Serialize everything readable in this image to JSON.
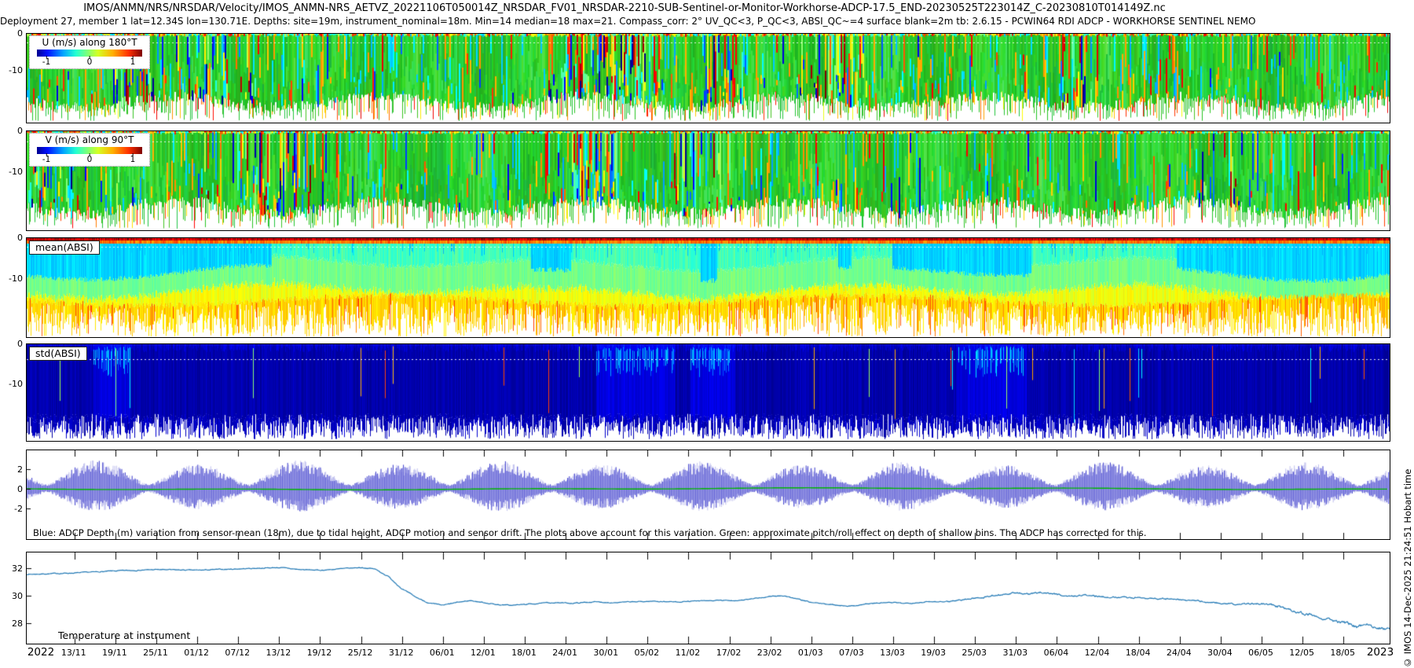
{
  "header": {
    "title_line1": "IMOS/ANMN/NRS/NRSDAR/Velocity/IMOS_ANMN-NRS_AETVZ_20221106T050014Z_NRSDAR_FV01_NRSDAR-2210-SUB-Sentinel-or-Monitor-Workhorse-ADCP-17.5_END-20230525T223014Z_C-20230810T014149Z.nc",
    "title_line2": "Deployment 27, member 1 lat=12.34S lon=130.71E. Depths: site=19m, instrument_nominal=18m. Min=14 median=18 max=21. Compass_corr: 2° UV_QC<3, P_QC<3, ABSI_QC~=4 surface blank=2m tb: 2.6.15 - PCWIN64 RDI ADCP - WORKHORSE SENTINEL NEMO"
  },
  "credit_vertical": "© IMOS 14-Dec-2025 21:24:51 Hobart time",
  "colors": {
    "temperature_line": "#1f77b4",
    "tide_blue": "#2d2dc8",
    "pitch_roll_green": "#00b400",
    "std_navy": "#000f96"
  },
  "panels": [
    {
      "label": "U (m/s) along 180°T",
      "colorbar_ticks": [
        "-1",
        "0",
        "1"
      ],
      "y_ticks": [
        {
          "label": "0",
          "frac": 0.0
        },
        {
          "label": "-10",
          "frac": 0.41
        }
      ]
    },
    {
      "label": "V (m/s) along 90°T",
      "colorbar_ticks": [
        "-1",
        "0",
        "1"
      ],
      "y_ticks": [
        {
          "label": "0",
          "frac": 0.0
        },
        {
          "label": "-10",
          "frac": 0.41
        }
      ]
    },
    {
      "label": "mean(ABSI)",
      "y_ticks": [
        {
          "label": "0",
          "frac": 0.0
        },
        {
          "label": "-10",
          "frac": 0.41
        }
      ]
    },
    {
      "label": "std(ABSI)",
      "y_ticks": [
        {
          "label": "0",
          "frac": 0.0
        },
        {
          "label": "-10",
          "frac": 0.41
        }
      ]
    },
    {
      "annotation": "Blue: ADCP Depth (m) variation from sensor-mean (18m), due to tidal height, ADCP motion and sensor drift. The plots above account for this variation. Green: approximate pitch/roll effect on depth of shallow bins. The ADCP has corrected for this.",
      "y_ticks": [
        {
          "label": "2",
          "frac": 0.217
        },
        {
          "label": "0",
          "frac": 0.435
        },
        {
          "label": "-2",
          "frac": 0.652
        }
      ]
    },
    {
      "label": "Temperature at instrument",
      "y_ticks": [
        {
          "label": "32",
          "frac": 0.178
        },
        {
          "label": "30",
          "frac": 0.475
        },
        {
          "label": "28",
          "frac": 0.772
        }
      ]
    }
  ],
  "x_axis": {
    "start_year_label": "2022",
    "end_year_label": "2023",
    "first_tick_day": 7,
    "tick_interval_days": 6,
    "total_days": 200,
    "date_labels": [
      "13/11",
      "19/11",
      "25/11",
      "01/12",
      "07/12",
      "13/12",
      "19/12",
      "25/12",
      "31/12",
      "06/01",
      "12/01",
      "18/01",
      "24/01",
      "30/01",
      "05/02",
      "11/02",
      "17/02",
      "23/02",
      "01/03",
      "07/03",
      "13/03",
      "19/03",
      "25/03",
      "31/03",
      "06/04",
      "12/04",
      "18/04",
      "24/04",
      "30/04",
      "06/05",
      "12/05",
      "18/05"
    ]
  },
  "chart_data": [
    {
      "panel": "u_velocity",
      "type": "heatmap",
      "label": "U (m/s) along 180°T",
      "colormap": "jet",
      "colorbar_range": [
        -1,
        1
      ],
      "colorbar_tick_labels": [
        "-1",
        "0",
        "1"
      ],
      "depth_tick_labels": [
        "0",
        "-10"
      ],
      "x_range": "06 Nov 2022 – 25 May 2023",
      "appearance": "time-depth velocity profiles, predominantly green (~0 to 0.3 m/s) vertical columns with scattered cyan, yellow, orange, red and dark-blue columns and ragged column bottoms"
    },
    {
      "panel": "v_velocity",
      "type": "heatmap",
      "label": "V (m/s) along 90°T",
      "colormap": "jet",
      "colorbar_range": [
        -1,
        1
      ],
      "colorbar_tick_labels": [
        "-1",
        "0",
        "1"
      ],
      "depth_tick_labels": [
        "0",
        "-10"
      ],
      "x_range": "06 Nov 2022 – 25 May 2023",
      "appearance": "same style as U panel; mostly green with sporadic multicoloured event columns"
    },
    {
      "panel": "mean_absi",
      "type": "heatmap",
      "label": "mean(ABSI)",
      "colormap": "jet",
      "depth_tick_labels": [
        "0",
        "-10"
      ],
      "appearance": "red/orange band at surface, cyan-turquoise upper layer, green middle, yellow lower layer ending in ragged yellow/orange spikes; darker green patches in several time intervals"
    },
    {
      "panel": "std_absi",
      "type": "heatmap",
      "label": "std(ABSI)",
      "colormap": "jet",
      "depth_tick_labels": [
        "0",
        "-10"
      ],
      "appearance": "uniform dark navy field with sparse bright cyan/green/orange vertical streaks and a white dotted horizontal line near the surface"
    },
    {
      "panel": "depth_variation",
      "type": "line",
      "y_tick_labels": [
        "2",
        "0",
        "-2"
      ],
      "series": [
        {
          "name": "ADCP depth variation from sensor-mean (m)",
          "color": "#2d2dc8",
          "pattern": "semidiurnal tidal spikes, amplitude modulated by ~14.77-day spring-neap cycle between about 0.5 m and 3 m"
        },
        {
          "name": "approximate pitch/roll effect",
          "color": "#00b400",
          "pattern": "nearly flat line at 0 m"
        }
      ],
      "spring_neap_period_days": 14.77,
      "max_amplitude_m": 2.8,
      "min_amplitude_m": 0.45,
      "annotation": "Blue: ADCP Depth (m) variation from sensor-mean (18m), due to tidal height, ADCP motion and sensor drift. The plots above account for this variation. Green: approximate pitch/roll effect on depth of shallow bins. The ADCP has corrected for this."
    },
    {
      "panel": "temperature",
      "type": "line",
      "label": "Temperature at instrument",
      "unit": "°C",
      "y_tick_labels": [
        "32",
        "30",
        "28"
      ],
      "color": "#1f77b4",
      "control_points_day_degC": [
        [
          0,
          31.55
        ],
        [
          7,
          31.65
        ],
        [
          13,
          31.8
        ],
        [
          19,
          31.9
        ],
        [
          25,
          31.85
        ],
        [
          28,
          31.9
        ],
        [
          31,
          31.95
        ],
        [
          34,
          32.0
        ],
        [
          37,
          32.05
        ],
        [
          40,
          31.9
        ],
        [
          43,
          31.85
        ],
        [
          46,
          31.95
        ],
        [
          49,
          32.05
        ],
        [
          51,
          31.95
        ],
        [
          53,
          31.4
        ],
        [
          55,
          30.5
        ],
        [
          57,
          29.9
        ],
        [
          59,
          29.45
        ],
        [
          61,
          29.3
        ],
        [
          63,
          29.5
        ],
        [
          65,
          29.65
        ],
        [
          67,
          29.5
        ],
        [
          69,
          29.35
        ],
        [
          71,
          29.3
        ],
        [
          74,
          29.4
        ],
        [
          77,
          29.5
        ],
        [
          80,
          29.45
        ],
        [
          83,
          29.55
        ],
        [
          86,
          29.5
        ],
        [
          89,
          29.55
        ],
        [
          92,
          29.6
        ],
        [
          95,
          29.55
        ],
        [
          98,
          29.6
        ],
        [
          101,
          29.65
        ],
        [
          104,
          29.65
        ],
        [
          107,
          29.8
        ],
        [
          109,
          29.95
        ],
        [
          111,
          30.0
        ],
        [
          113,
          29.75
        ],
        [
          115,
          29.5
        ],
        [
          117,
          29.4
        ],
        [
          119,
          29.3
        ],
        [
          121,
          29.25
        ],
        [
          123,
          29.4
        ],
        [
          126,
          29.5
        ],
        [
          129,
          29.45
        ],
        [
          132,
          29.55
        ],
        [
          135,
          29.6
        ],
        [
          138,
          29.75
        ],
        [
          141,
          29.95
        ],
        [
          143,
          30.1
        ],
        [
          145,
          30.2
        ],
        [
          147,
          30.1
        ],
        [
          149,
          30.25
        ],
        [
          151,
          30.1
        ],
        [
          153,
          29.95
        ],
        [
          155,
          30.05
        ],
        [
          157,
          29.95
        ],
        [
          160,
          29.9
        ],
        [
          163,
          29.85
        ],
        [
          166,
          29.8
        ],
        [
          169,
          29.7
        ],
        [
          172,
          29.6
        ],
        [
          175,
          29.45
        ],
        [
          177,
          29.35
        ],
        [
          179,
          29.4
        ],
        [
          181,
          29.45
        ],
        [
          183,
          29.3
        ],
        [
          185,
          29.05
        ],
        [
          187,
          28.75
        ],
        [
          189,
          28.55
        ],
        [
          191,
          28.3
        ],
        [
          193,
          28.0
        ],
        [
          195,
          27.75
        ],
        [
          197,
          27.85
        ],
        [
          199,
          27.6
        ],
        [
          200,
          27.55
        ]
      ]
    }
  ]
}
